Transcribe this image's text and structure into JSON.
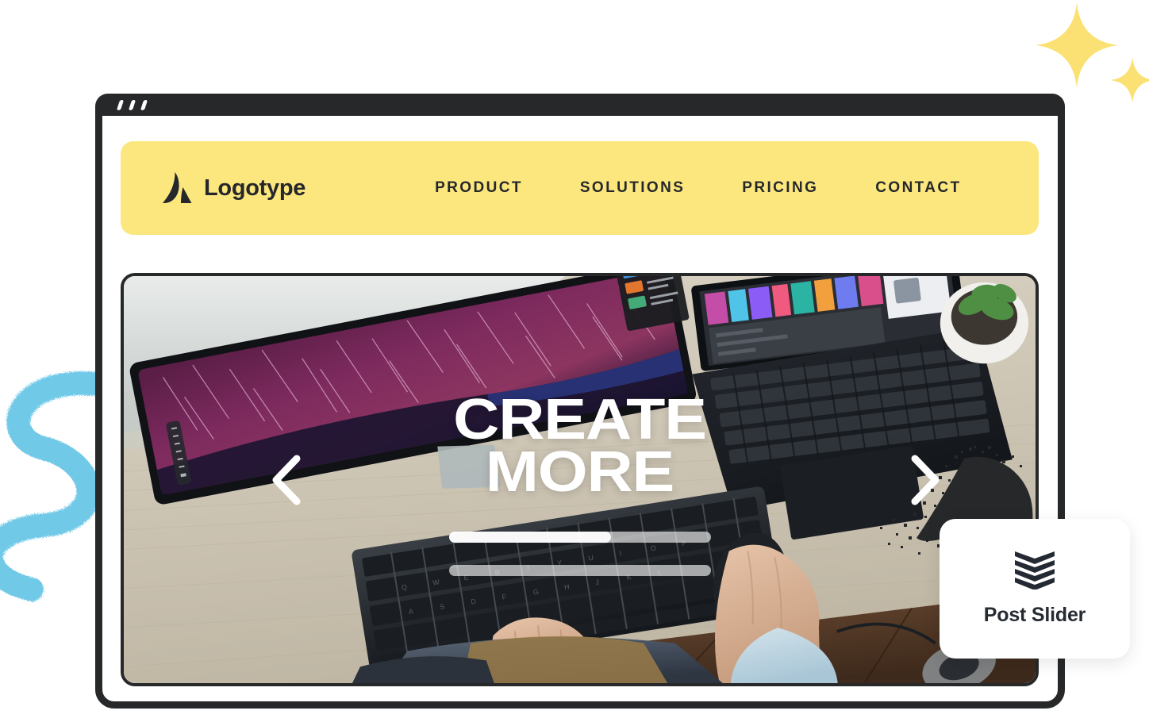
{
  "window": {
    "title": "",
    "traffic_dots": [
      "dot-1",
      "dot-2",
      "dot-3"
    ]
  },
  "nav": {
    "logo_icon": "logo-mark-a-icon",
    "brand": "Logotype",
    "links": [
      {
        "label": "PRODUCT"
      },
      {
        "label": "SOLUTIONS"
      },
      {
        "label": "PRICING"
      },
      {
        "label": "CONTACT"
      }
    ]
  },
  "hero": {
    "headline_line1": "CREATE",
    "headline_line2": "MORE",
    "prev_icon": "chevron-left-icon",
    "next_icon": "chevron-right-icon",
    "progress_bars": [
      {
        "name": "slide-progress-1",
        "fill_percent": 62
      },
      {
        "name": "slide-progress-2",
        "fill_percent": 0
      }
    ],
    "image_alt": "desk with ultrawide monitor showing purple star trails, laptop, keyboard and mouse"
  },
  "post_slider_card": {
    "icon": "stacked-chevrons-icon",
    "label": "Post Slider"
  },
  "decorations": {
    "sparkle_large": "sparkle-icon",
    "sparkle_small": "sparkle-icon",
    "blue_squiggle": "brush-squiggle-shape",
    "dust_effect": "particle-dissolve-shape"
  },
  "colors": {
    "brand_yellow": "#FBE77D",
    "sparkle_yellow": "#FBE173",
    "dark": "#272829",
    "accent_blue": "#71C9E8",
    "white": "#FFFFFF"
  }
}
